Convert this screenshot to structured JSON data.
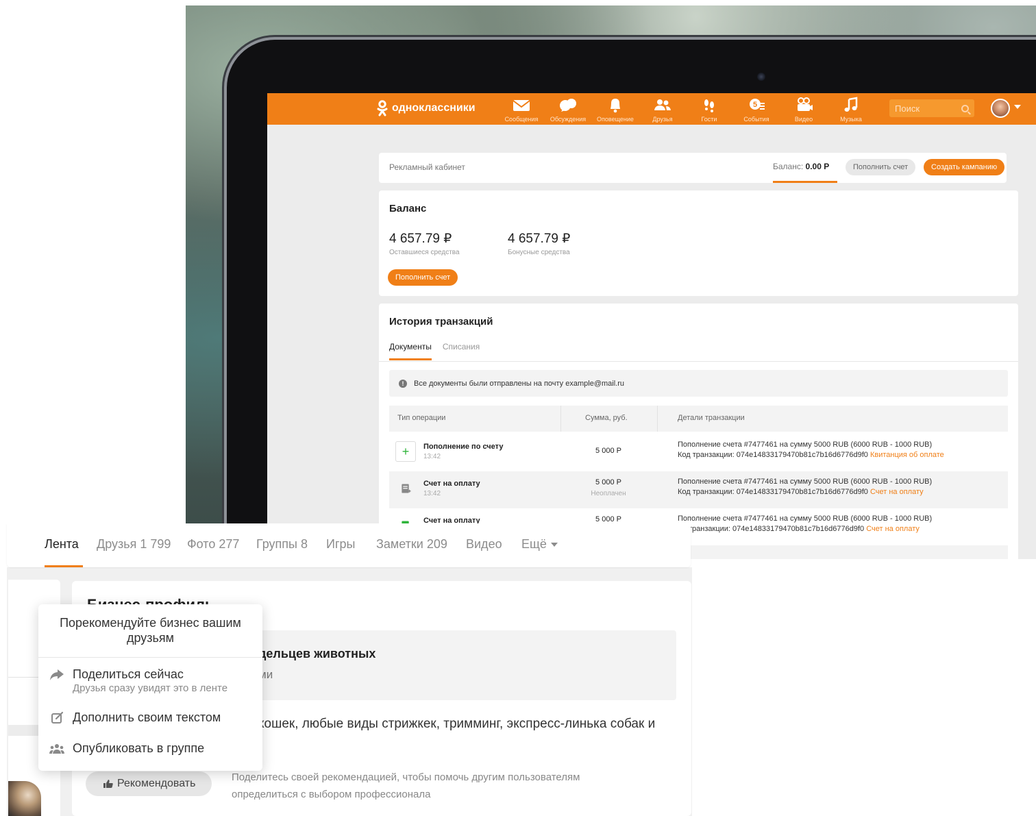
{
  "okapp": {
    "logo_text": "одноклассники",
    "nav": [
      {
        "label": "Сообщения",
        "icon": "envelope-icon"
      },
      {
        "label": "Обсуждения",
        "icon": "chat-bubbles-icon"
      },
      {
        "label": "Оповещение",
        "icon": "bell-icon"
      },
      {
        "label": "Друзья",
        "icon": "friends-icon"
      },
      {
        "label": "Гости",
        "icon": "footprints-icon"
      },
      {
        "label": "События",
        "icon": "events-icon"
      },
      {
        "label": "Видео",
        "icon": "video-camera-icon"
      },
      {
        "label": "Музыка",
        "icon": "music-note-icon"
      }
    ],
    "search_placeholder": "Поиск",
    "accent_color": "#f07f17"
  },
  "ad_cabinet": {
    "title": "Рекламный кабинет",
    "balance_label": "Баланс:",
    "balance_value": "0.00 Р",
    "topup_label": "Пополнить счет",
    "create_label": "Создать кампанию"
  },
  "balance": {
    "heading": "Баланс",
    "remaining_amount": "4 657.79 ₽",
    "remaining_label": "Оставшиеся средства",
    "bonus_amount": "4 657.79 ₽",
    "bonus_label": "Бонусные средства",
    "topup_label": "Пополнить счет"
  },
  "history": {
    "heading": "История транзакций",
    "tabs": [
      "Документы",
      "Списания"
    ],
    "notice": "Все документы были отправлены на почту example@mail.ru",
    "columns": [
      "Тип операции",
      "Сумма, руб.",
      "Детали транзакции"
    ],
    "rows": [
      {
        "title": "Пополнение по счету",
        "time": "13:42",
        "sum": "5 000 Р",
        "sum_status": "",
        "details": "Пополнение счета #7477461 на сумму 5000 RUB (6000 RUB - 1000 RUB)",
        "code": "Код транзакции: 074e14833179470b81c7b16d6776d9f0",
        "link": "Квитанция об оплате"
      },
      {
        "title": "Счет на оплату",
        "time": "13:42",
        "sum": "5 000 Р",
        "sum_status": "Неоплачен",
        "details": "Пополнение счета #7477461 на сумму 5000 RUB (6000 RUB - 1000 RUB)",
        "code": "Код транзакции: 074e14833179470b81c7b16d6776d9f0",
        "link": "Счет на оплату"
      },
      {
        "title": "Счет на оплату",
        "time": "",
        "sum": "5 000 Р",
        "sum_status": "",
        "details": "Пополнение счета #7477461 на сумму 5000 RUB (6000 RUB - 1000 RUB)",
        "code": "транзакции: 074e14833179470b81c7b16d6776d9f0",
        "link": "Счет на оплату"
      }
    ]
  },
  "profile": {
    "tabs": [
      {
        "label": "Лента"
      },
      {
        "label": "Друзья 1 799"
      },
      {
        "label": "Фото 277"
      },
      {
        "label": "Группы 8"
      },
      {
        "label": "Игры"
      },
      {
        "label": "Заметки 209"
      },
      {
        "label": "Видео"
      },
      {
        "label": "Ещё"
      }
    ],
    "business_title": "Бизнес-профиль",
    "business_name_fragment": "дельцев животных",
    "business_sub_fragment": "ми",
    "business_desc_fragment": "кошек, любые виды стрижкек, тримминг, экспресс-линька собак и",
    "recommend_button": "Рекомендовать",
    "recommend_note": "Поделитесь своей рекомендацией, чтобы помочь другим пользователям определиться с выбором профессионала"
  },
  "popup": {
    "title": "Порекомендуйте бизнес вашим друзьям",
    "items": [
      {
        "label": "Поделиться сейчас",
        "sub": "Друзья сразу увидят это в ленте",
        "icon": "share-arrow-icon"
      },
      {
        "label": "Дополнить своим текстом",
        "sub": "",
        "icon": "edit-icon"
      },
      {
        "label": "Опубликовать в группе",
        "sub": "",
        "icon": "group-icon"
      }
    ]
  }
}
